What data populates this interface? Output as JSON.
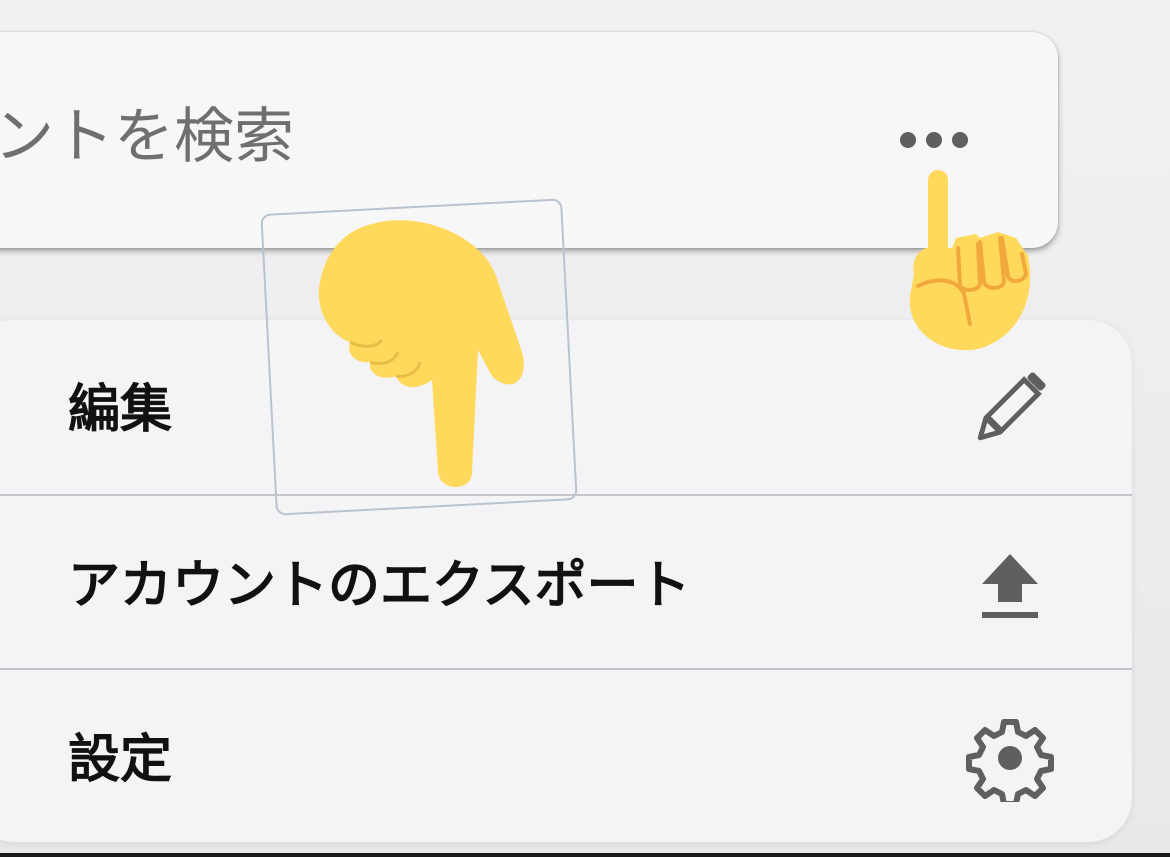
{
  "search": {
    "placeholder_visible": "ントを検索",
    "more_icon": "ellipsis-icon"
  },
  "menu": {
    "items": [
      {
        "label": "編集",
        "icon": "pencil-icon"
      },
      {
        "label": "アカウントのエクスポート",
        "icon": "upload-icon"
      },
      {
        "label": "設定",
        "icon": "gear-icon"
      }
    ]
  },
  "colors": {
    "icon": "#5f5f62",
    "emoji_hand": "#ffd95c",
    "emoji_outline": "#f2a93b",
    "divider": "#c6c6ca"
  },
  "overlays": {
    "big_hand_icon": "pointing-down-hand-icon",
    "small_hand_icon": "pointing-up-hand-icon"
  }
}
